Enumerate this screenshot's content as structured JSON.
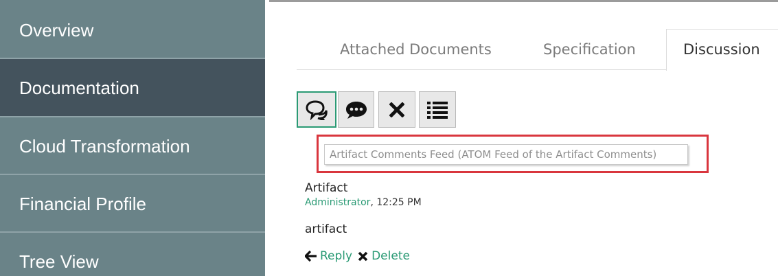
{
  "sidebar": {
    "items": [
      {
        "label": "Overview",
        "active": false
      },
      {
        "label": "Documentation",
        "active": true
      },
      {
        "label": "Cloud Transformation",
        "active": false
      },
      {
        "label": "Financial Profile",
        "active": false
      },
      {
        "label": "Tree View",
        "active": false
      }
    ]
  },
  "tabs": [
    {
      "label": "Attached Documents",
      "active": false
    },
    {
      "label": "Specification",
      "active": false
    },
    {
      "label": "Discussion",
      "active": true
    }
  ],
  "toolbar": {
    "buttons": [
      {
        "icon": "comments-feed-icon",
        "focused": true
      },
      {
        "icon": "comment-bubble-icon",
        "focused": false
      },
      {
        "icon": "close-icon",
        "focused": false
      },
      {
        "icon": "list-icon",
        "focused": false
      }
    ]
  },
  "tooltip": {
    "text": "Artifact Comments Feed (ATOM Feed of the Artifact Comments)"
  },
  "comment": {
    "title": "Artifact",
    "author": "Administrator",
    "time_suffix": ", 12:25 PM",
    "body": "artifact",
    "reply_label": "Reply",
    "delete_label": "Delete"
  },
  "colors": {
    "sidebar_bg": "#6a8388",
    "sidebar_active_bg": "#44535d",
    "accent_green": "#2a9a74",
    "highlight_red": "#d9363e"
  }
}
